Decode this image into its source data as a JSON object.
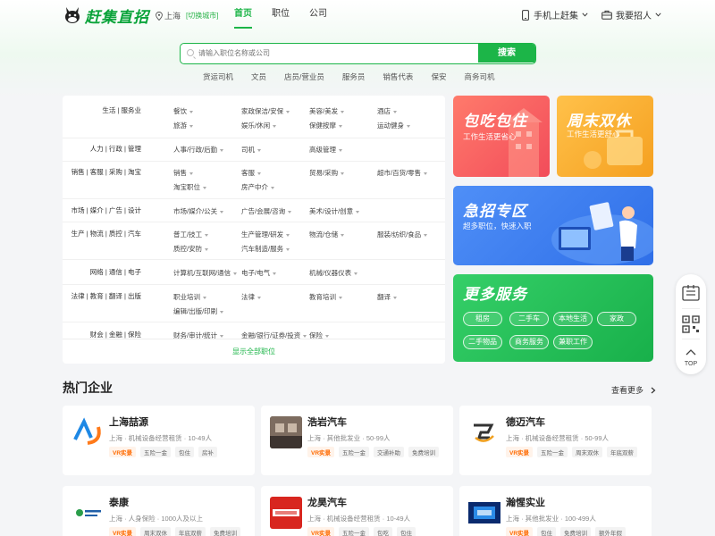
{
  "header": {
    "logo_text": "赶集直招",
    "city": "上海",
    "switch_city": "[切换城市]",
    "nav": [
      "首页",
      "职位",
      "公司"
    ],
    "mobile_label": "手机上赶集",
    "recruit_label": "我要招人"
  },
  "search": {
    "placeholder": "请输入职位名称或公司",
    "button": "搜索",
    "hot_keywords": [
      "货运司机",
      "文员",
      "店员/营业员",
      "服务员",
      "销售代表",
      "保安",
      "商务司机"
    ]
  },
  "categories": [
    {
      "title": "生活 | 服务业",
      "items": [
        "餐饮",
        "家政保洁/安保",
        "美容/美发",
        "酒店",
        "旅游",
        "娱乐/休闲",
        "保健按摩",
        "运动健身"
      ]
    },
    {
      "title": "人力 | 行政 | 管理",
      "items": [
        "人事/行政/后勤",
        "司机",
        "高级管理"
      ]
    },
    {
      "title": "销售 | 客服 | 采购 | 淘宝",
      "items": [
        "销售",
        "客服",
        "贸易/采购",
        "超市/百货/零售",
        "淘宝职位",
        "房产中介"
      ]
    },
    {
      "title": "市场 | 媒介 | 广告 | 设计",
      "items": [
        "市场/媒介/公关",
        "广告/会展/咨询",
        "美术/设计/创意"
      ]
    },
    {
      "title": "生产 | 物流 | 质控 | 汽车",
      "items": [
        "普工/技工",
        "生产管理/研发",
        "物流/仓储",
        "服装/纺织/食品",
        "质控/安防",
        "汽车制造/服务"
      ]
    },
    {
      "title": "网络 | 通信 | 电子",
      "items": [
        "计算机/互联网/通信",
        "电子/电气",
        "机械/仪器仪表"
      ]
    },
    {
      "title": "法律 | 教育 | 翻译 | 出版",
      "items": [
        "职业培训",
        "法律",
        "教育培训",
        "翻译",
        "编辑/出版/印刷"
      ]
    },
    {
      "title": "财会 | 金融 | 保险",
      "items": [
        "财务/审计/统计",
        "金融/银行/证券/投资",
        "保险"
      ]
    }
  ],
  "show_all": "显示全部职位",
  "banners": {
    "b1": {
      "title": "包吃包住",
      "sub": "工作生活更省心",
      "color": "#f25a5a"
    },
    "b2": {
      "title": "周末双休",
      "sub": "工作生活更舒心",
      "color": "#f5a623"
    },
    "b3": {
      "title": "急招专区",
      "sub": "超多职位，快速入职",
      "color": "#3b82f6"
    },
    "b4": {
      "title": "更多服务",
      "services": [
        "租房",
        "二手车",
        "本地生活",
        "家政",
        "二手物品",
        "商务服务",
        "兼职工作"
      ],
      "color": "#22c05a"
    }
  },
  "float": {
    "top_label": "TOP"
  },
  "hot": {
    "title": "热门企业",
    "more": "查看更多",
    "companies": [
      {
        "name": "上海喆源",
        "info": "上海 · 机械设备经营租赁 · 10-49人",
        "tags": [
          "VR实景",
          "五险一金",
          "包住",
          "房补"
        ]
      },
      {
        "name": "浩岩汽车",
        "info": "上海 · 其他批发业 · 50-99人",
        "tags": [
          "VR实景",
          "五险一金",
          "交通补助",
          "免费培训"
        ]
      },
      {
        "name": "德迈汽车",
        "info": "上海 · 机械设备经营租赁 · 50-99人",
        "tags": [
          "VR实景",
          "五险一金",
          "周末双休",
          "年底双薪"
        ]
      },
      {
        "name": "泰康",
        "info": "上海 · 人身保险 · 1000人及以上",
        "tags": [
          "VR实景",
          "周末双休",
          "年底双薪",
          "免费培训"
        ]
      },
      {
        "name": "龙昊汽车",
        "info": "上海 · 机械设备经营租赁 · 10-49人",
        "tags": [
          "VR实景",
          "五险一金",
          "包吃",
          "包住"
        ]
      },
      {
        "name": "瀚惺实业",
        "info": "上海 · 其他批发业 · 100-499人",
        "tags": [
          "VR实景",
          "包住",
          "免费培训",
          "额外年假"
        ]
      }
    ]
  }
}
